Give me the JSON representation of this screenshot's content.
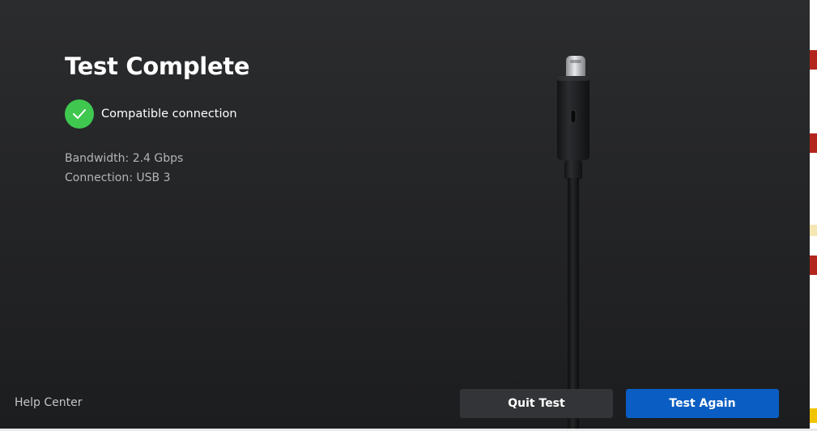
{
  "dialog": {
    "title": "Test Complete",
    "status": {
      "icon": "check-circle-icon",
      "text": "Compatible connection",
      "color": "#3fc750"
    },
    "details": {
      "bandwidth": "Bandwidth: 2.4 Gbps",
      "connection": "Connection: USB 3"
    },
    "illustration": "usb-c-cable-illustration",
    "footer": {
      "help_label": "Help Center",
      "quit_label": "Quit Test",
      "again_label": "Test Again"
    }
  },
  "colors": {
    "primary_button": "#0a5dc2",
    "secondary_button": "#333437",
    "background": "#242527"
  }
}
